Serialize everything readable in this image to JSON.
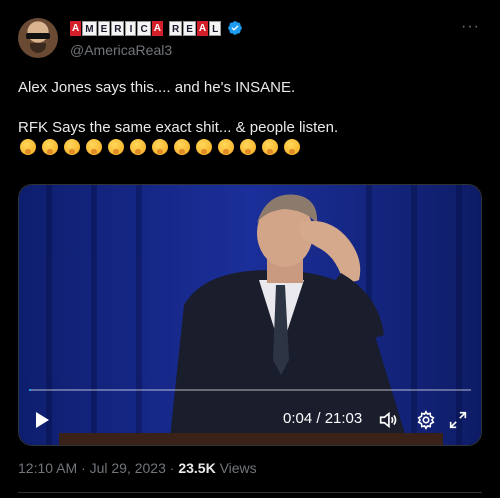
{
  "author": {
    "display_name_words": [
      {
        "letters": [
          {
            "ch": "A",
            "style": "red"
          },
          {
            "ch": "M",
            "style": "white"
          },
          {
            "ch": "E",
            "style": "white"
          },
          {
            "ch": "R",
            "style": "white"
          },
          {
            "ch": "I",
            "style": "white"
          },
          {
            "ch": "C",
            "style": "white"
          },
          {
            "ch": "A",
            "style": "red"
          }
        ]
      },
      {
        "letters": [
          {
            "ch": "R",
            "style": "white"
          },
          {
            "ch": "E",
            "style": "white"
          },
          {
            "ch": "A",
            "style": "red"
          },
          {
            "ch": "L",
            "style": "white"
          }
        ]
      }
    ],
    "handle": "@AmericaReal3",
    "verified_icon": "verified-badge-icon"
  },
  "more_label": "···",
  "tweet": {
    "line1": "Alex Jones says this.... and he's INSANE.",
    "line2": "RFK Says the same exact shit... & people listen.",
    "emoji_name": "thinking-face",
    "emoji_count": 13
  },
  "video": {
    "time_label": "0:04 / 21:03",
    "progress_fraction": 0.003,
    "icons": [
      "play-icon",
      "volume-icon",
      "settings-gear-icon",
      "fullscreen-icon"
    ]
  },
  "meta": {
    "timestamp": "12:10 AM · Jul 29, 2023",
    "separator": " · ",
    "views_count": "23.5K",
    "views_label": " Views"
  },
  "colors": {
    "background": "#000000",
    "accent": "#1d9bf0",
    "muted": "#71767b",
    "text": "#e7e9ea"
  }
}
